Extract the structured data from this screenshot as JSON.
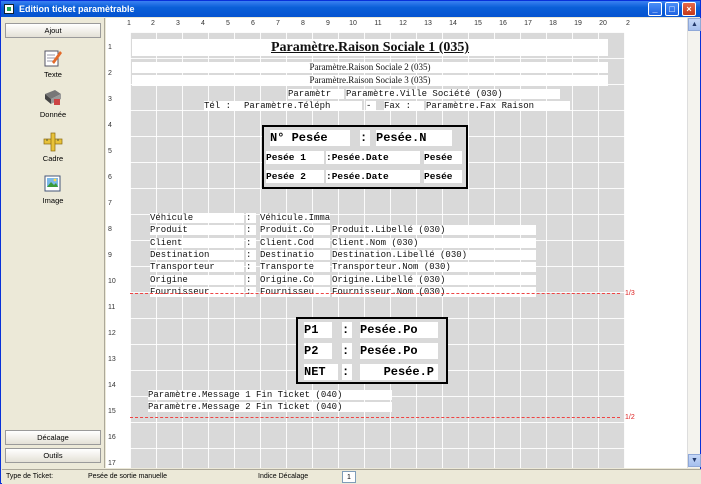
{
  "window": {
    "title": "Edition ticket paramètrable"
  },
  "sidebar": {
    "top_button": "Ajout",
    "tools": [
      {
        "label": "Texte",
        "icon": "pen-notepad-icon"
      },
      {
        "label": "Donnée",
        "icon": "data-drill-icon"
      },
      {
        "label": "Cadre",
        "icon": "frame-ruler-icon"
      },
      {
        "label": "Image",
        "icon": "picture-icon"
      }
    ],
    "bottom_buttons": [
      "Décalage",
      "Outils"
    ]
  },
  "ruler": {
    "top": [
      "1",
      "2",
      "3",
      "4",
      "5",
      "6",
      "7",
      "8",
      "9",
      "10",
      "11",
      "12",
      "13",
      "14",
      "15",
      "16",
      "17",
      "18",
      "19",
      "20",
      "2"
    ],
    "left": [
      "1",
      "2",
      "3",
      "4",
      "5",
      "6",
      "7",
      "8",
      "9",
      "10",
      "11",
      "12",
      "13",
      "14",
      "15",
      "16",
      "17"
    ]
  },
  "ticket": {
    "header1": "Paramètre.Raison Sociale 1 (035)",
    "header2": "Paramètre.Raison Sociale 2 (035)",
    "header3": "Paramètre.Raison Sociale 3 (035)",
    "line4a": "Paramètr",
    "line4b": "Paramètre.Ville Société (030)",
    "tel_label": "Tél :",
    "tel_val": "Paramètre.Téléph",
    "dash": "-",
    "fax_label": "Fax :",
    "fax_val": "Paramètre.Fax Raison",
    "pesee_label": "N° Pesée",
    "pesee_colon": ":",
    "pesee_val": "Pesée.N",
    "pesee1_label": "Pesée 1",
    "pesee1_date": ":Pesée.Date",
    "pesee1_time": "Pesée",
    "pesee2_label": "Pesée 2",
    "pesee2_date": ":Pesée.Date",
    "pesee2_time": "Pesée",
    "details": [
      {
        "label": "Véhicule",
        "colon": ":",
        "v1": "Véhicule.Immatr",
        "v2": ""
      },
      {
        "label": "Produit",
        "colon": ":",
        "v1": "Produit.Co",
        "v2": "Produit.Libellé (030)"
      },
      {
        "label": "Client",
        "colon": ":",
        "v1": "Client.Cod",
        "v2": "Client.Nom (030)"
      },
      {
        "label": "Destination",
        "colon": ":",
        "v1": "Destinatio",
        "v2": "Destination.Libellé (030)"
      },
      {
        "label": "Transporteur",
        "colon": ":",
        "v1": "Transporte",
        "v2": "Transporteur.Nom (030)"
      },
      {
        "label": "Origine",
        "colon": ":",
        "v1": "Origine.Co",
        "v2": "Origine.Libellé (030)"
      },
      {
        "label": "Fournisseur",
        "colon": ":",
        "v1": "Fournisseu",
        "v2": "Fournisseur.Nom (030)"
      }
    ],
    "weights": [
      {
        "label": "P1",
        "colon": ":",
        "val": "Pesée.Po"
      },
      {
        "label": "P2",
        "colon": ":",
        "val": "Pesée.Po"
      },
      {
        "label": "NET",
        "colon": ":",
        "val": "Pesée.P"
      }
    ],
    "msg1": "Paramètre.Message 1 Fin Ticket (040)",
    "msg2": "Paramètre.Message 2 Fin Ticket (040)",
    "page_mark1": "1/3",
    "page_mark2": "1/2"
  },
  "status": {
    "type_label": "Type de Ticket:",
    "type_value": "Pesée de sortie manuelle",
    "indice_label": "Indice Décalage",
    "indice_value": "1"
  },
  "colors": {
    "titlebar": "#0A5FD8",
    "grid": "#d9d9d9",
    "page_break": "#e44444"
  }
}
